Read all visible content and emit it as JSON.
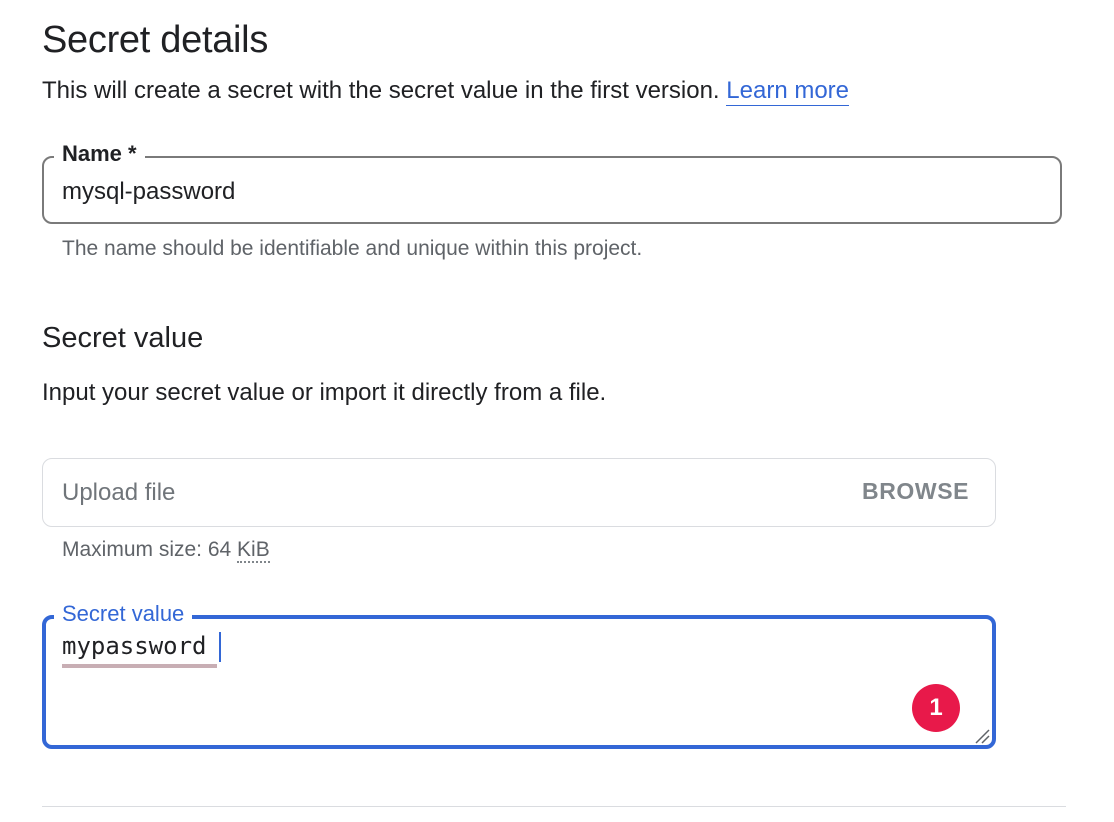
{
  "header": {
    "title": "Secret details",
    "subtitle": "This will create a secret with the secret value in the first version.",
    "learn_more": "Learn more"
  },
  "name_field": {
    "label": "Name *",
    "value": "mysql-password",
    "hint": "The name should be identifiable and unique within this project."
  },
  "secret_section": {
    "title": "Secret value",
    "description": "Input your secret value or import it directly from a file."
  },
  "upload": {
    "placeholder": "Upload file",
    "browse_label": "BROWSE",
    "hint_prefix": "Maximum size: 64 ",
    "hint_unit": "KiB"
  },
  "secret_field": {
    "label": "Secret value",
    "value": "mypassword"
  },
  "badge": {
    "count": "1",
    "color": "#e8194a"
  },
  "colors": {
    "accent": "#3367d6",
    "text": "#202124",
    "muted": "#5f6368"
  }
}
